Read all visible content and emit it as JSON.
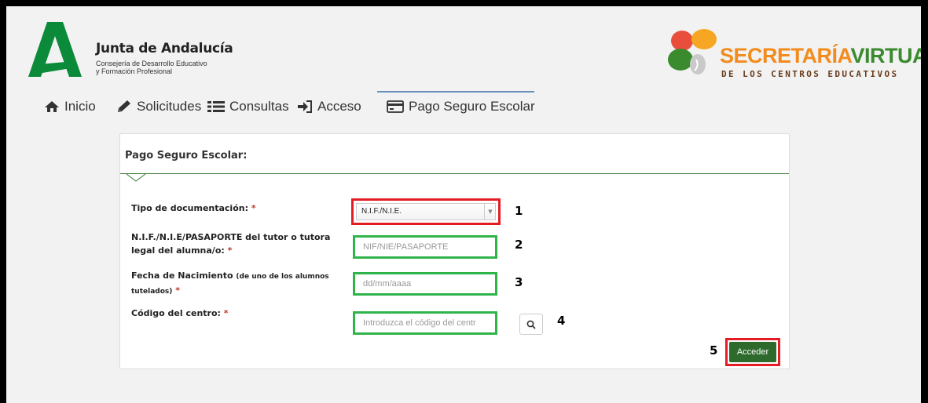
{
  "header": {
    "brand_title": "Junta de Andalucía",
    "brand_sub_line1": "Consejería de Desarrollo Educativo",
    "brand_sub_line2": "y Formación Profesional",
    "sv_title_part1": "SECRETARÍA",
    "sv_title_part2": "VIRTUAL",
    "sv_subtitle": "DE LOS CENTROS EDUCATIVOS"
  },
  "nav": {
    "items": [
      {
        "label": "Inicio",
        "icon": "home-icon"
      },
      {
        "label": "Solicitudes",
        "icon": "pencil-icon"
      },
      {
        "label": "Consultas",
        "icon": "list-icon"
      },
      {
        "label": "Acceso",
        "icon": "sign-in-icon"
      },
      {
        "label": "Pago Seguro Escolar",
        "icon": "credit-card-icon",
        "active": true
      }
    ]
  },
  "form": {
    "title": "Pago Seguro Escolar:",
    "tipo_label": "Tipo de documentación:",
    "tipo_value": "N.I.F./N.I.E.",
    "nif_label_line1": "N.I.F./N.I.E/PASAPORTE del tutor o tutora",
    "nif_label_line2": "legal del alumna/o:",
    "nif_placeholder": "NIF/NIE/PASAPORTE",
    "fecha_label_main": "Fecha de Nacimiento",
    "fecha_label_small1": "(de uno de los alumnos",
    "fecha_label_small2": "tutelados)",
    "fecha_placeholder": "dd/mm/aaaa",
    "codigo_label": "Código del centro:",
    "codigo_placeholder": "Introduzca el código del centr",
    "required_mark": "*",
    "submit_label": "Acceder"
  },
  "annotations": [
    "1",
    "2",
    "3",
    "4",
    "5"
  ],
  "colors": {
    "highlight_red": "#e41c23",
    "highlight_green": "#2fb44a",
    "submit_green": "#2d6a2b",
    "junta_green": "#0b8a3a"
  }
}
